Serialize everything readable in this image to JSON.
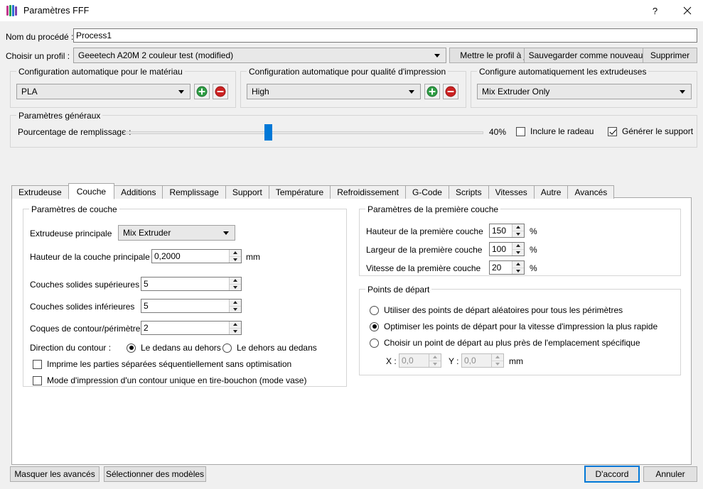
{
  "window": {
    "title": "Paramètres FFF",
    "icon": "fff-cube-icon",
    "help_label": "?",
    "close_label": "✕",
    "icon_colors": [
      "#c3378f",
      "#20a450",
      "#2a6fd4",
      "#7a3fb0"
    ]
  },
  "process": {
    "name_label": "Nom du procédé :",
    "name_value": "Process1",
    "profile_label": "Choisir un profil :",
    "profile_value": "Geeetech A20M 2 couleur test (modified)",
    "update_profile_button": "Mettre le profil à jour",
    "save_as_new_button": "Sauvegarder comme nouveau",
    "delete_button": "Supprimer"
  },
  "auto_config": {
    "material": {
      "legend": "Configuration automatique pour le matériau",
      "value": "PLA",
      "add_label": "+",
      "remove_label": "−"
    },
    "quality": {
      "legend": "Configuration automatique pour qualité d'impression",
      "value": "High",
      "add_label": "+",
      "remove_label": "−"
    },
    "extruders": {
      "legend": "Configure automatiquement les extrudeuses",
      "value": "Mix Extruder Only"
    }
  },
  "general": {
    "legend": "Paramètres généraux",
    "infill_label": "Pourcentage de remplissage :",
    "infill_value": "40%",
    "infill_percent": 40,
    "raft_label": "Inclure le radeau",
    "raft_checked": false,
    "support_label": "Générer le support",
    "support_checked": true
  },
  "tabs": [
    {
      "label": "Extrudeuse",
      "active": false
    },
    {
      "label": "Couche",
      "active": true
    },
    {
      "label": "Additions",
      "active": false
    },
    {
      "label": "Remplissage",
      "active": false
    },
    {
      "label": "Support",
      "active": false
    },
    {
      "label": "Température",
      "active": false
    },
    {
      "label": "Refroidissement",
      "active": false
    },
    {
      "label": "G-Code",
      "active": false
    },
    {
      "label": "Scripts",
      "active": false
    },
    {
      "label": "Vitesses",
      "active": false
    },
    {
      "label": "Autre",
      "active": false
    },
    {
      "label": "Avancés",
      "active": false
    }
  ],
  "layer_settings": {
    "legend": "Paramètres de couche",
    "primary_extruder_label": "Extrudeuse principale",
    "primary_extruder_value": "Mix Extruder",
    "primary_layer_height_label": "Hauteur de la couche principale",
    "primary_layer_height_value": "0,2000",
    "primary_layer_height_unit": "mm",
    "top_solid_label": "Couches solides supérieures",
    "top_solid_value": "5",
    "bottom_solid_label": "Couches solides inférieures",
    "bottom_solid_value": "5",
    "perimeter_shells_label": "Coques de contour/périmètre",
    "perimeter_shells_value": "2",
    "outline_direction_label": "Direction du contour :",
    "outline_inside_out": "Le dedans au dehors",
    "outline_outside_in": "Le dehors au dedans",
    "outline_selected": "inside_out",
    "sequential_label": "Imprime les parties séparées séquentiellement sans optimisation",
    "sequential_checked": false,
    "vase_label": "Mode d'impression d'un contour unique en tire-bouchon (mode vase)",
    "vase_checked": false
  },
  "first_layer": {
    "legend": "Paramètres de la première couche",
    "height_label": "Hauteur de la première couche",
    "height_value": "150",
    "height_unit": "%",
    "width_label": "Largeur de la première couche",
    "width_value": "100",
    "width_unit": "%",
    "speed_label": "Vitesse de la première couche",
    "speed_value": "20",
    "speed_unit": "%"
  },
  "start_points": {
    "legend": "Points de départ",
    "random_label": "Utiliser des points de départ aléatoires pour tous les périmètres",
    "optimize_label": "Optimiser les points de départ pour la vitesse d'impression la plus rapide",
    "specific_label": "Choisir un point de départ au plus près de l'emplacement spécifique",
    "selected": "optimize",
    "x_label": "X :",
    "x_value": "0,0",
    "y_label": "Y :",
    "y_value": "0,0",
    "unit": "mm"
  },
  "footer": {
    "hide_advanced_button": "Masquer les avancés",
    "select_models_button": "Sélectionner des modèles",
    "ok_button": "D'accord",
    "cancel_button": "Annuler"
  },
  "colors": {
    "accent": "#0078d7",
    "add_green": "#2f9e44",
    "remove_red": "#cc2222",
    "window_bg": "#f0f0f0",
    "panel_bg": "#ffffff"
  }
}
